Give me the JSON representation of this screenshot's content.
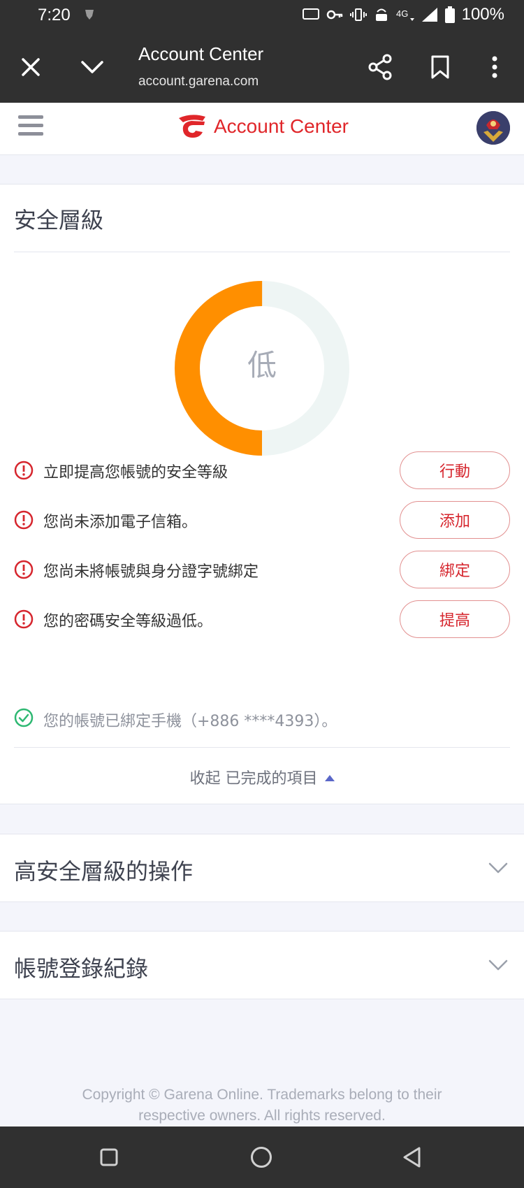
{
  "status_bar": {
    "time": "7:20",
    "battery": "100%"
  },
  "browser": {
    "title": "Account Center",
    "url": "account.garena.com"
  },
  "site": {
    "brand_name": "Account Center",
    "brand_color": "#e0262a"
  },
  "security": {
    "title": "安全層級",
    "level_label": "低",
    "level_fraction": 0.5,
    "gauge_color": "#ff8f00",
    "gauge_track_color": "#eef5f4",
    "issues": [
      {
        "text": "立即提高您帳號的安全等級",
        "action": "行動"
      },
      {
        "text": "您尚未添加電子信箱。",
        "action": "添加"
      },
      {
        "text": "您尚未將帳號與身分證字號綁定",
        "action": "綁定"
      },
      {
        "text": "您的密碼安全等級過低。",
        "action": "提高"
      }
    ],
    "completed": "您的帳號已綁定手機（+886 ****4393）。",
    "collapse_label": "收起 已完成的項目"
  },
  "sections": [
    {
      "title": "高安全層級的操作"
    },
    {
      "title": "帳號登錄紀錄"
    }
  ],
  "footer": {
    "copyright": "Copyright © Garena Online. Trademarks belong to their respective owners. All rights reserved."
  }
}
